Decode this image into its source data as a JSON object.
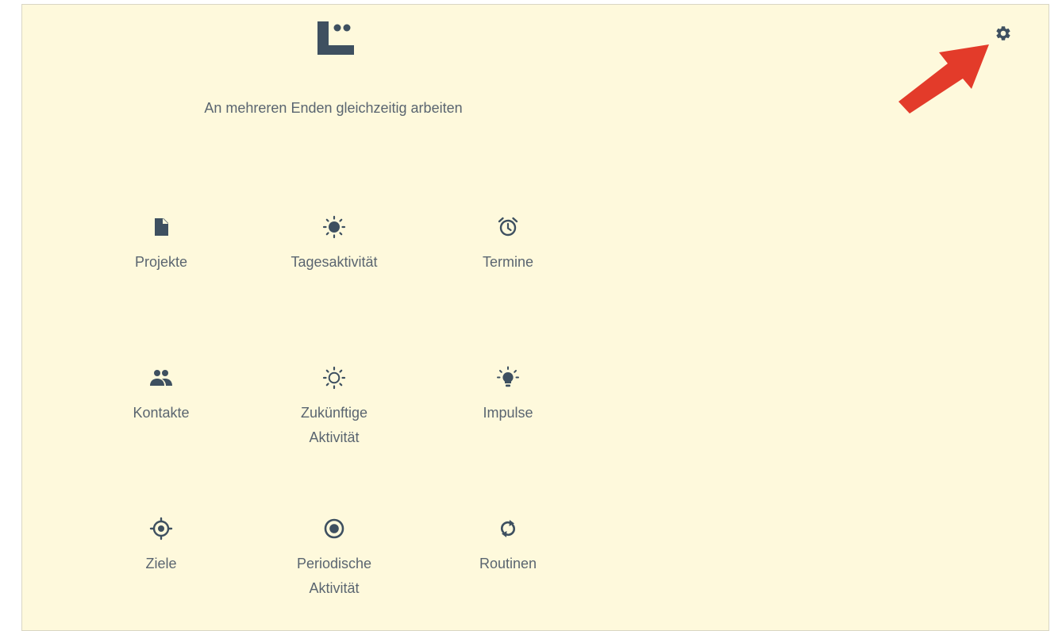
{
  "header": {
    "logo_icon": "logo-icon",
    "tagline": "An mehreren Enden gleichzeitig arbeiten",
    "settings_icon": "gear-icon"
  },
  "colors": {
    "background": "#fef9dc",
    "icon": "#3e5060",
    "text": "#5a6570",
    "annotation_arrow": "#e33b2a"
  },
  "menu": [
    {
      "label": "Projekte",
      "icon": "file-icon"
    },
    {
      "label": "Tagesaktivität",
      "icon": "sun-icon"
    },
    {
      "label": "Termine",
      "icon": "alarm-clock-icon"
    },
    {
      "label": "Kontakte",
      "icon": "people-icon"
    },
    {
      "label": "Zukünftige\nAktivität",
      "icon": "sun-outline-icon"
    },
    {
      "label": "Impulse",
      "icon": "lightbulb-icon"
    },
    {
      "label": "Ziele",
      "icon": "target-icon"
    },
    {
      "label": "Periodische\nAktivität",
      "icon": "radio-button-icon"
    },
    {
      "label": "Routinen",
      "icon": "refresh-icon"
    }
  ]
}
